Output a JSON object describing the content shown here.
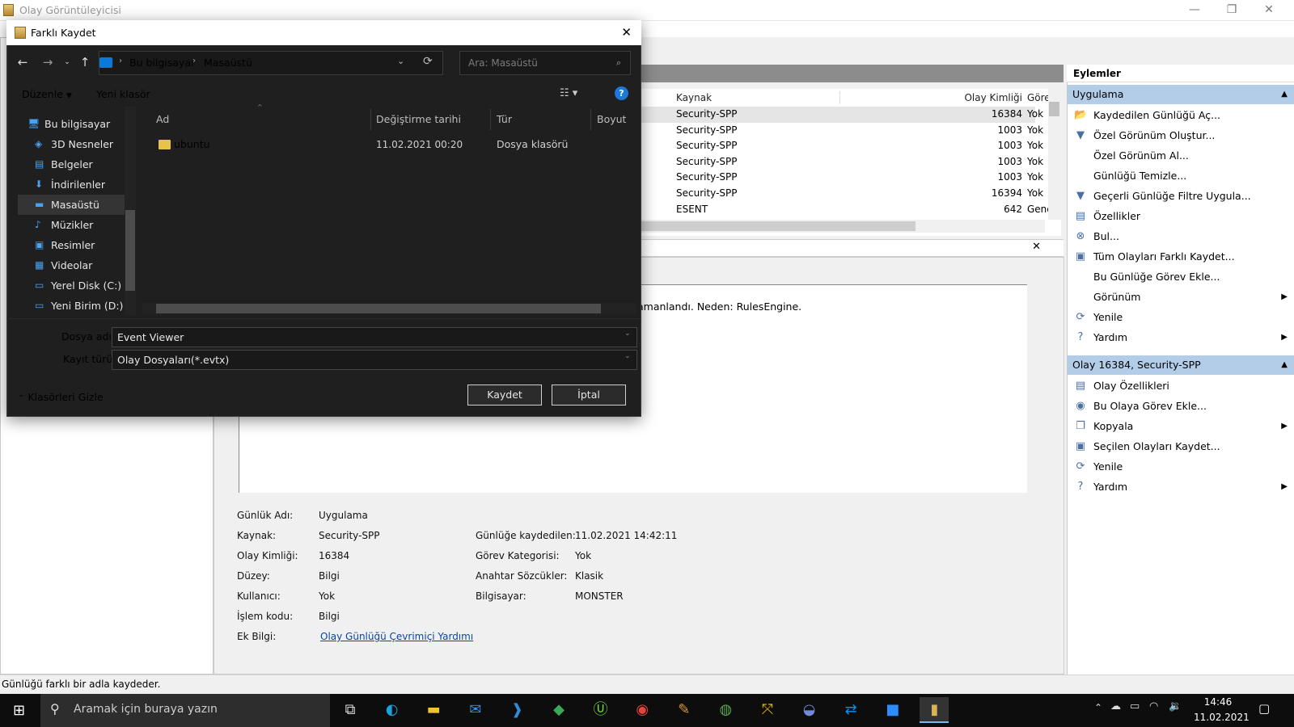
{
  "app": {
    "title": "Olay Görüntüleyicisi",
    "status_bar": "Günlüğü farklı bir adla kaydeder.",
    "min_glyph": "—",
    "max_glyph": "❐",
    "close_glyph": "✕"
  },
  "event_grid": {
    "columns": [
      "Kaynak",
      "Olay Kimliği",
      "Görev"
    ],
    "rows": [
      {
        "source": "Security-SPP",
        "id": "16384",
        "task": "Yok"
      },
      {
        "source": "Security-SPP",
        "id": "1003",
        "task": "Yok"
      },
      {
        "source": "Security-SPP",
        "id": "1003",
        "task": "Yok"
      },
      {
        "source": "Security-SPP",
        "id": "1003",
        "task": "Yok"
      },
      {
        "source": "Security-SPP",
        "id": "1003",
        "task": "Yok"
      },
      {
        "source": "Security-SPP",
        "id": "16394",
        "task": "Yok"
      },
      {
        "source": "ESENT",
        "id": "642",
        "task": "Genel"
      }
    ]
  },
  "detail": {
    "description_tail": "amanlandı. Neden: RulesEngine.",
    "close_glyph": "✕",
    "left_props": [
      {
        "label": "Günlük Adı:",
        "value": "Uygulama"
      },
      {
        "label": "Kaynak:",
        "value": "Security-SPP"
      },
      {
        "label": "Olay Kimliği:",
        "value": "16384"
      },
      {
        "label": "Düzey:",
        "value": "Bilgi"
      },
      {
        "label": "Kullanıcı:",
        "value": "Yok"
      },
      {
        "label": "İşlem kodu:",
        "value": "Bilgi"
      },
      {
        "label": "Ek Bilgi:",
        "value": "Olay Günlüğü Çevrimiçi Yardımı"
      }
    ],
    "right_props": [
      {
        "label": "Günlüğe kaydedilen:",
        "value": "11.02.2021 14:42:11"
      },
      {
        "label": "Görev Kategorisi:",
        "value": "Yok"
      },
      {
        "label": "Anahtar Sözcükler:",
        "value": "Klasik"
      },
      {
        "label": "Bilgisayar:",
        "value": "MONSTER"
      }
    ]
  },
  "actions": {
    "title": "Eylemler",
    "section1": "Uygulama",
    "items1": [
      {
        "label": "Kaydedilen Günlüğü Aç...",
        "icon": "folder-open-icon",
        "glyph": "📂"
      },
      {
        "label": "Özel Görünüm Oluştur...",
        "icon": "filter-icon",
        "glyph": "▼"
      },
      {
        "label": "Özel Görünüm Al...",
        "icon": "",
        "glyph": ""
      },
      {
        "label": "Günlüğü Temizle...",
        "icon": "",
        "glyph": ""
      },
      {
        "label": "Geçerli Günlüğe Filtre Uygula...",
        "icon": "filter-icon",
        "glyph": "▼"
      },
      {
        "label": "Özellikler",
        "icon": "properties-icon",
        "glyph": "▤"
      },
      {
        "label": "Bul...",
        "icon": "binoculars-icon",
        "glyph": "⊗"
      },
      {
        "label": "Tüm Olayları Farklı Kaydet...",
        "icon": "save-icon",
        "glyph": "▣"
      },
      {
        "label": "Bu Günlüğe Görev Ekle...",
        "icon": "",
        "glyph": ""
      },
      {
        "label": "Görünüm",
        "icon": "",
        "glyph": "",
        "submenu": true
      },
      {
        "label": "Yenile",
        "icon": "refresh-icon",
        "glyph": "⟳"
      },
      {
        "label": "Yardım",
        "icon": "help-icon",
        "glyph": "?",
        "submenu": true
      }
    ],
    "section2": "Olay 16384, Security-SPP",
    "items2": [
      {
        "label": "Olay Özellikleri",
        "icon": "properties-icon",
        "glyph": "▤"
      },
      {
        "label": "Bu Olaya Görev Ekle...",
        "icon": "task-icon",
        "glyph": "◉"
      },
      {
        "label": "Kopyala",
        "icon": "copy-icon",
        "glyph": "❐",
        "submenu": true
      },
      {
        "label": "Seçilen Olayları Kaydet...",
        "icon": "save-icon",
        "glyph": "▣"
      },
      {
        "label": "Yenile",
        "icon": "refresh-icon",
        "glyph": "⟳"
      },
      {
        "label": "Yardım",
        "icon": "help-icon",
        "glyph": "?",
        "submenu": true
      }
    ]
  },
  "dialog": {
    "title": "Farklı Kaydet",
    "close_glyph": "✕",
    "breadcrumb": [
      "Bu bilgisayar",
      "Masaüstü"
    ],
    "search_placeholder": "Ara: Masaüstü",
    "toolbar": {
      "organize": "Düzenle",
      "new_folder": "Yeni klasör"
    },
    "tree": [
      {
        "label": "Bu bilgisayar",
        "icon": "computer-icon",
        "glyph": "🖥"
      },
      {
        "label": "3D Nesneler",
        "icon": "cube-icon",
        "glyph": "◈"
      },
      {
        "label": "Belgeler",
        "icon": "documents-icon",
        "glyph": "▤"
      },
      {
        "label": "İndirilenler",
        "icon": "download-icon",
        "glyph": "⬇"
      },
      {
        "label": "Masaüstü",
        "icon": "desktop-icon",
        "glyph": "▬"
      },
      {
        "label": "Müzikler",
        "icon": "music-icon",
        "glyph": "♪"
      },
      {
        "label": "Resimler",
        "icon": "pictures-icon",
        "glyph": "▣"
      },
      {
        "label": "Videolar",
        "icon": "video-icon",
        "glyph": "▦"
      },
      {
        "label": "Yerel Disk (C:)",
        "icon": "disk-icon",
        "glyph": "▭"
      },
      {
        "label": "Yeni Birim (D:)",
        "icon": "drive-icon",
        "glyph": "▭"
      }
    ],
    "columns": [
      "Ad",
      "Değiştirme tarihi",
      "Tür",
      "Boyut"
    ],
    "files": [
      {
        "name": "ubuntu",
        "date": "11.02.2021 00:20",
        "type": "Dosya klasörü",
        "size": ""
      }
    ],
    "filename_label": "Dosya adı:",
    "filename_value": "Event Viewer",
    "filetype_label": "Kayıt türü:",
    "filetype_value": "Olay Dosyaları(*.evtx)",
    "hide_folders": "Klasörleri Gizle",
    "save": "Kaydet",
    "cancel": "İptal"
  },
  "taskbar": {
    "search_placeholder": "Aramak için buraya yazın",
    "time": "14:46",
    "date": "11.02.2021",
    "apps": [
      "task-view",
      "edge",
      "file-explorer",
      "mail",
      "vscode",
      "app-green",
      "upwork",
      "chrome",
      "paint",
      "app-globe",
      "app-arrows",
      "discord",
      "teamviewer",
      "zoom",
      "event-viewer"
    ]
  }
}
